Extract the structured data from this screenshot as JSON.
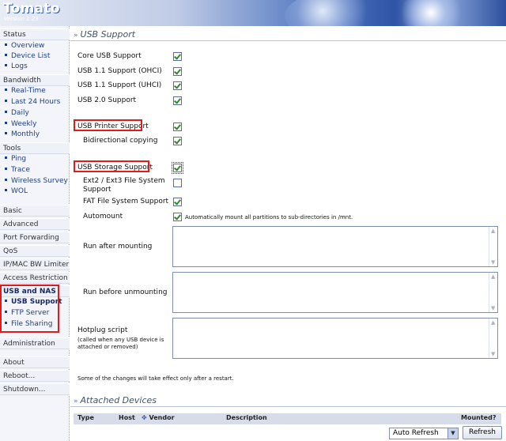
{
  "app": {
    "title": "Tomato",
    "version": "Version 1.23"
  },
  "sidebar": {
    "sections": [
      {
        "label": "Status",
        "items": [
          "Overview",
          "Device List",
          "Logs"
        ]
      },
      {
        "label": "Bandwidth",
        "items": [
          "Real-Time",
          "Last 24 Hours",
          "Daily",
          "Weekly",
          "Monthly"
        ]
      },
      {
        "label": "Tools",
        "items": [
          "Ping",
          "Trace",
          "Wireless Survey",
          "WOL"
        ]
      },
      {
        "label": "Basic"
      },
      {
        "label": "Advanced"
      },
      {
        "label": "Port Forwarding"
      },
      {
        "label": "QoS"
      },
      {
        "label": "IP/MAC BW Limiter"
      },
      {
        "label": "Access Restriction"
      },
      {
        "label": "USB and NAS",
        "items": [
          "USB Support",
          "FTP Server",
          "File Sharing"
        ],
        "active_item": "USB Support"
      },
      {
        "label": "Administration"
      },
      {
        "label": "About"
      },
      {
        "label": "Reboot..."
      },
      {
        "label": "Shutdown..."
      }
    ]
  },
  "usb": {
    "title": "USB Support",
    "core": {
      "label": "Core USB Support",
      "checked": true
    },
    "ohci": {
      "label": "USB 1.1 Support (OHCI)",
      "checked": true
    },
    "uhci": {
      "label": "USB 1.1 Support (UHCI)",
      "checked": true
    },
    "ehci": {
      "label": "USB 2.0 Support",
      "checked": true
    },
    "printer": {
      "label": "USB Printer Support",
      "checked": true
    },
    "bidir": {
      "label": "Bidirectional copying",
      "checked": true
    },
    "storage": {
      "label": "USB Storage Support",
      "checked": true
    },
    "ext": {
      "label_line1": "Ext2 / Ext3 File System",
      "label_line2": "Support",
      "checked": false
    },
    "fat": {
      "label": "FAT File System Support",
      "checked": true
    },
    "automount": {
      "label": "Automount",
      "checked": true,
      "note": "Automatically mount all partitions to sub-directories in /mnt."
    },
    "run_after": {
      "label": "Run after mounting",
      "value": ""
    },
    "run_before": {
      "label": "Run before unmounting",
      "value": ""
    },
    "hotplug": {
      "label": "Hotplug script",
      "sublabel_line1": "(called when any USB device is",
      "sublabel_line2": "attached or removed)",
      "value": ""
    },
    "restart_note": "Some of the changes will take effect only after a restart."
  },
  "devices": {
    "title": "Attached Devices",
    "columns": [
      "Type",
      "Host",
      "Vendor",
      "Description",
      "Mounted?"
    ],
    "refresh_interval": "Auto Refresh",
    "refresh_label": "Refresh"
  },
  "colors": {
    "highlight_box": "#e01b1b",
    "link": "#1e3f8a",
    "check": "#2f8a2f"
  }
}
